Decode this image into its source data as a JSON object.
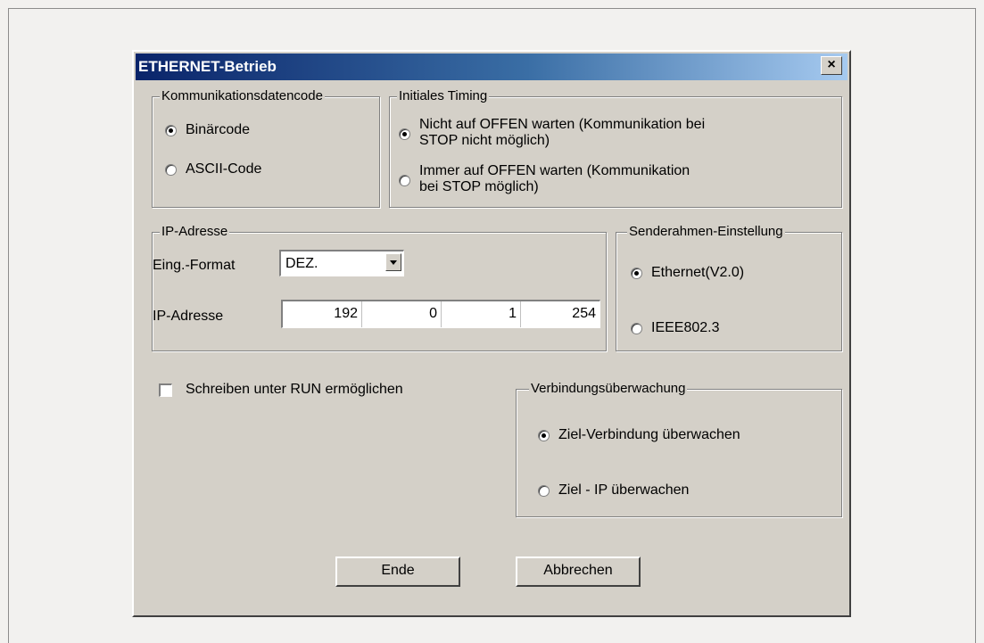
{
  "dialog": {
    "title": "ETHERNET-Betrieb",
    "close_glyph": "×"
  },
  "comm_code": {
    "legend": "Kommunikationsdatencode",
    "options": [
      {
        "label": "Binärcode",
        "checked": true
      },
      {
        "label": "ASCII-Code",
        "checked": false
      }
    ]
  },
  "timing": {
    "legend": "Initiales Timing",
    "options": [
      {
        "label_line1": "Nicht auf OFFEN warten (Kommunikation bei",
        "label_line2": "STOP nicht möglich)",
        "checked": true
      },
      {
        "label_line1": "Immer auf OFFEN warten (Kommunikation",
        "label_line2": "bei STOP möglich)",
        "checked": false
      }
    ]
  },
  "ip": {
    "legend": "IP-Adresse",
    "format_label": "Eing.-Format",
    "format_value": "DEZ.",
    "address_label": "IP-Adresse",
    "octets": [
      "192",
      "0",
      "1",
      "254"
    ]
  },
  "frame": {
    "legend": "Senderahmen-Einstellung",
    "options": [
      {
        "label": "Ethernet(V2.0)",
        "checked": true
      },
      {
        "label": "IEEE802.3",
        "checked": false
      }
    ]
  },
  "run_write": {
    "label": "Schreiben unter RUN ermöglichen",
    "checked": false
  },
  "monitor": {
    "legend": "Verbindungsüberwachung",
    "options": [
      {
        "label": "Ziel-Verbindung überwachen",
        "checked": true
      },
      {
        "label": "Ziel - IP überwachen",
        "checked": false
      }
    ]
  },
  "buttons": {
    "ok": "Ende",
    "cancel": "Abbrechen"
  }
}
